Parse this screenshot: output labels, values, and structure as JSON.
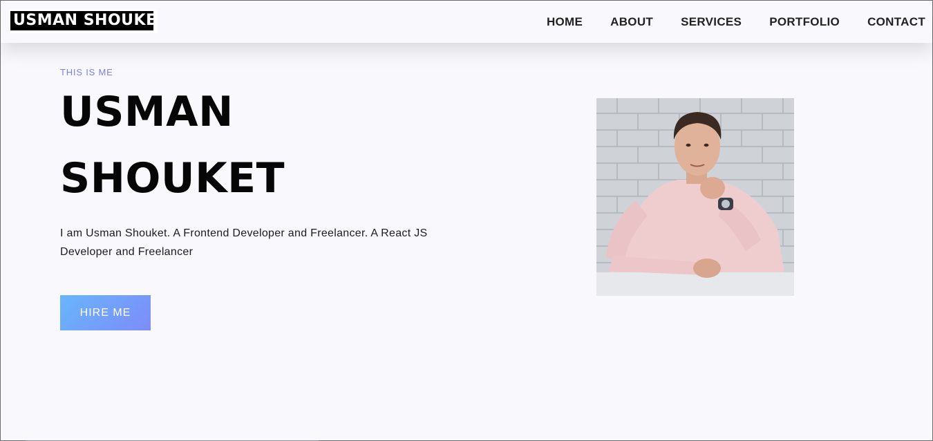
{
  "brand": {
    "logo_text": "USMAN SHOUKET"
  },
  "nav": {
    "items": [
      {
        "label": "HOME"
      },
      {
        "label": "ABOUT"
      },
      {
        "label": "SERVICES"
      },
      {
        "label": "PORTFOLIO"
      },
      {
        "label": "CONTACT"
      }
    ]
  },
  "hero": {
    "eyebrow": "THIS IS ME",
    "name_line_1": "USMAN",
    "name_line_2": "SHOUKET",
    "bio": "I am Usman Shouket. A Frontend Developer and Freelancer. A React JS Developer and Freelancer",
    "cta_label": "HIRE ME"
  },
  "colors": {
    "accent": "#7b7fe8",
    "button_gradient_start": "#68b6fb",
    "button_gradient_end": "#7d8cf9",
    "background": "#f8f8fd"
  }
}
